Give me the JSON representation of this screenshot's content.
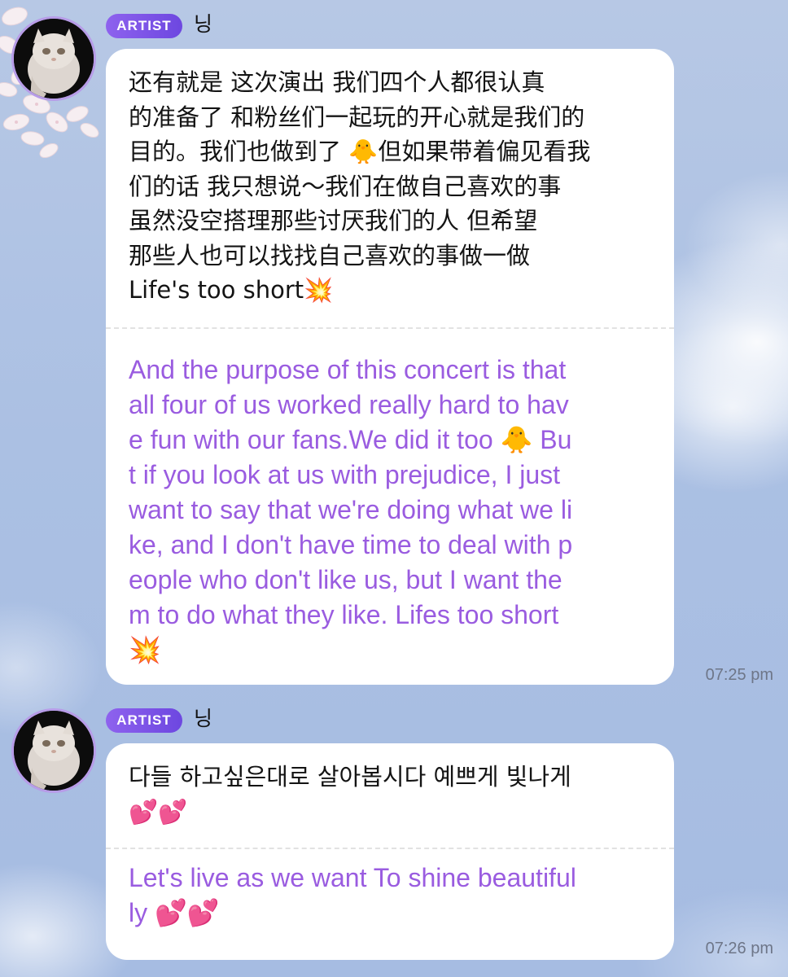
{
  "messages": [
    {
      "badge": "ARTIST",
      "sender": "닝",
      "original": "还有就是 这次演出 我们四个人都很认真\n的准备了 和粉丝们一起玩的开心就是我们的\n目的。我们也做到了 🐥但如果带着偏见看我\n们的话 我只想说～我们在做自己喜欢的事\n虽然没空搭理那些讨厌我们的人 但希望\n那些人也可以找找自己喜欢的事做一做\nLife's too short💥",
      "translation": "And the purpose of this concert is that\nall four of us worked really hard to hav\ne fun with our fans.We did it too 🐥 Bu\nt if you look at us with prejudice, I just\nwant to say that we're doing what we li\nke, and I don't have time to deal with p\neople who don't like us, but I want the\nm to do what they like. Lifes too short\n💥",
      "time": "07:25 pm"
    },
    {
      "badge": "ARTIST",
      "sender": "닝",
      "original": "다들 하고싶은대로 살아봅시다 예쁘게 빛나게\n💕💕",
      "translation": "Let's live as we want To shine beautiful\nly 💕💕",
      "time": "07:26 pm"
    }
  ],
  "colors": {
    "accent": "#7a52e6",
    "translation": "#9a5ce0",
    "sky": "#abc0e3"
  }
}
